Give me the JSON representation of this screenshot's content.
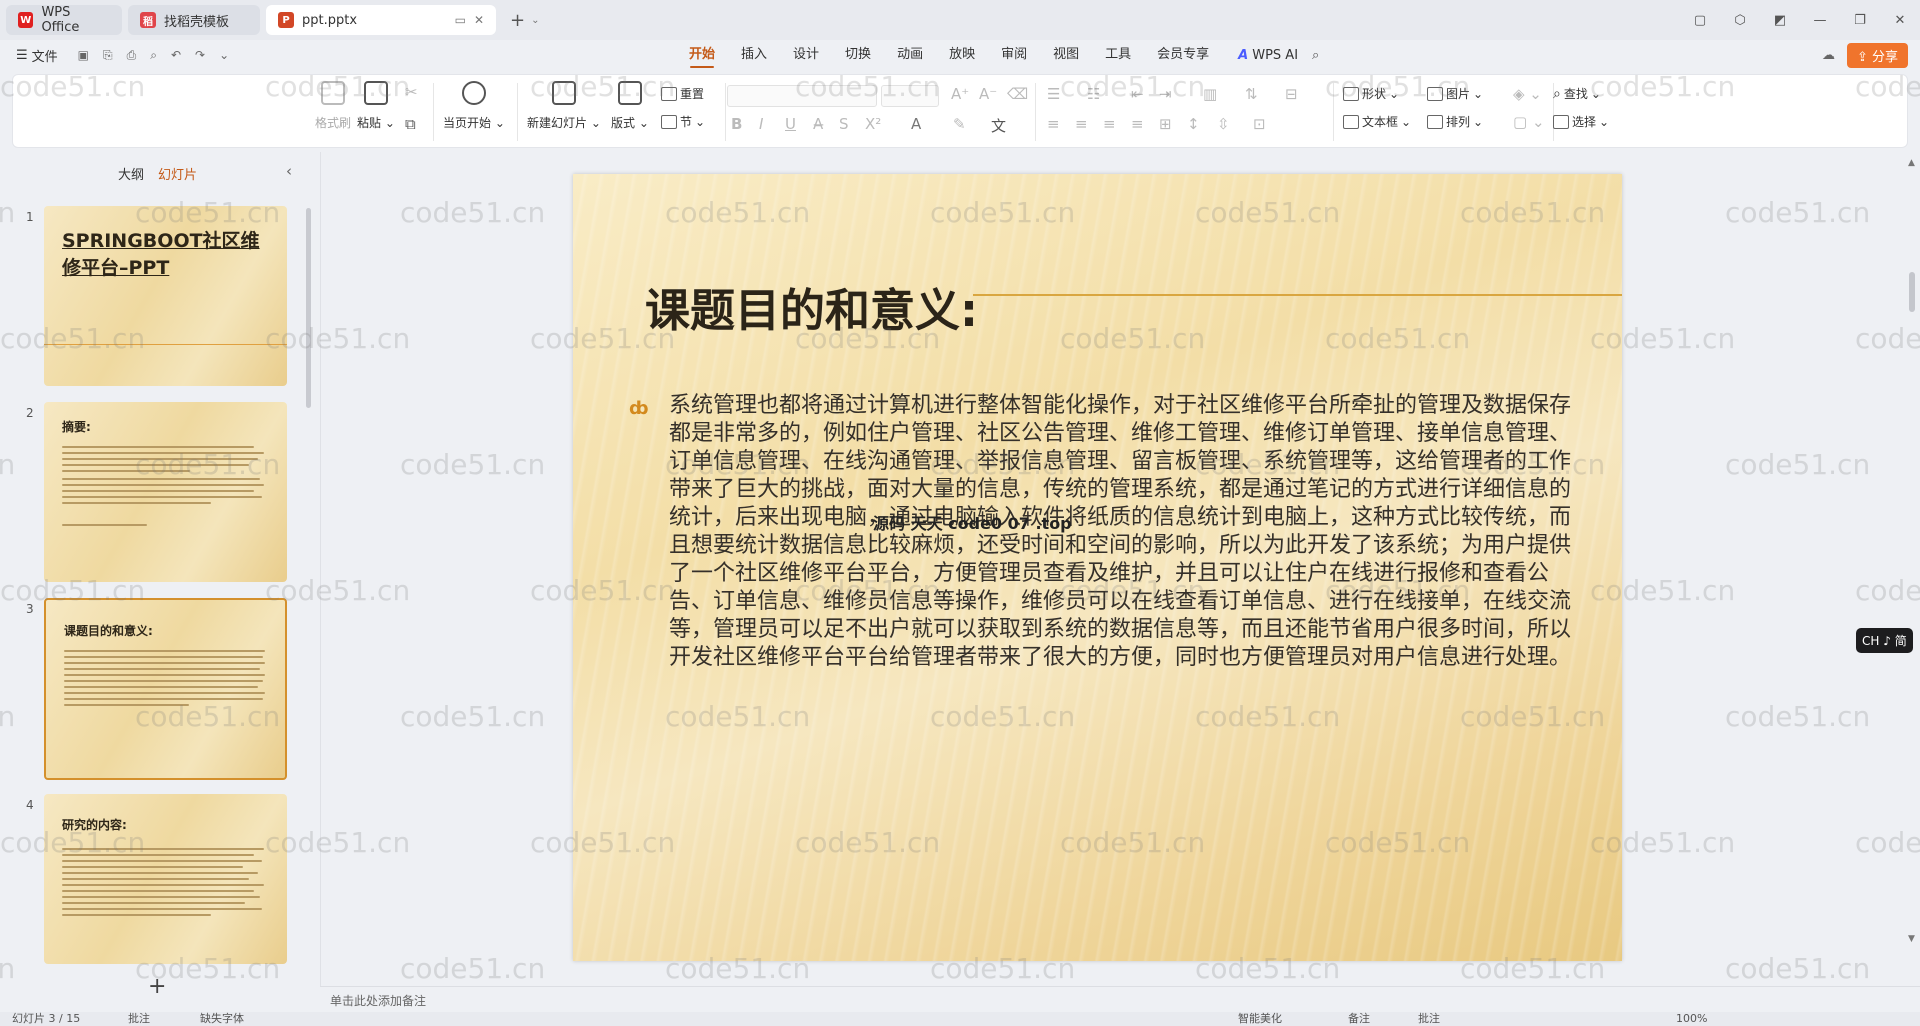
{
  "tabs": [
    {
      "label": "WPS Office",
      "icon": "wps-logo-icon",
      "color": "#e02020"
    },
    {
      "label": "找稻壳模板",
      "icon": "docer-icon",
      "color": "#e0454a"
    },
    {
      "label": "ppt.pptx",
      "icon": "ppt-file-icon",
      "color": "#d24726"
    }
  ],
  "menu": {
    "file": "文件",
    "items": [
      "开始",
      "插入",
      "设计",
      "切换",
      "动画",
      "放映",
      "审阅",
      "视图",
      "工具",
      "会员专享"
    ],
    "active": "开始",
    "wps_ai": "WPS AI",
    "share": "分享"
  },
  "ribbon": {
    "format_painter": "格式刷",
    "paste": "粘贴",
    "play_from_current": "当页开始",
    "new_slide": "新建幻灯片",
    "layout": "版式",
    "reset": "重置",
    "section": "节",
    "shape": "形状",
    "picture": "图片",
    "textbox": "文本框",
    "arrange": "排列",
    "find": "查找",
    "select": "选择"
  },
  "left_panel": {
    "tab_outline": "大纲",
    "tab_slides": "幻灯片",
    "thumbs": [
      {
        "num": "1",
        "title": "SPRINGBOOT社区维修平台–PPT"
      },
      {
        "num": "2",
        "title": "摘要:"
      },
      {
        "num": "3",
        "title": "课题目的和意义:"
      },
      {
        "num": "4",
        "title": "研究的内容:"
      }
    ],
    "selected_index": 3
  },
  "slide": {
    "title": "课题目的和意义:",
    "body": "系统管理也都将通过计算机进行整体智能化操作，对于社区维修平台所牵扯的管理及数据保存都是非常多的，例如住户管理、社区公告管理、维修工管理、维修订单管理、接单信息管理、订单信息管理、在线沟通管理、举报信息管理、留言板管理、系统管理等，这给管理者的工作带来了巨大的挑战，面对大量的信息，传统的管理系统，都是通过笔记的方式进行详细信息的统计，后来出现电脑，通过电脑输入软件将纸质的信息统计到电脑上，这种方式比较传统，而且想要统计数据信息比较麻烦，还受时间和空间的影响，所以为此开发了该系统；为用户提供了一个社区维修平台平台，方便管理员查看及维护，并且可以让住户在线进行报修和查看公告、订单信息、维修员信息等操作，维修员可以在线查看订单信息、进行在线接单，在线交流等，管理员可以足不出户就可以获取到系统的数据信息等，而且还能节省用户很多时间，所以开发社区维修平台平台给管理者带来了很大的方便，同时也方便管理员对用户信息进行处理。",
    "overlay": "源码 天天 code0 07 .top"
  },
  "notes_placeholder": "单击此处添加备注",
  "ime": "CH ♪ 简",
  "status": {
    "slide_info": "幻灯片 3 / 15",
    "comments": "批注",
    "missing_font": "缺失字体",
    "smart_beautify": "智能美化",
    "notes": "备注",
    "comments2": "批注",
    "zoom": "100%"
  },
  "watermark": "code51.cn"
}
